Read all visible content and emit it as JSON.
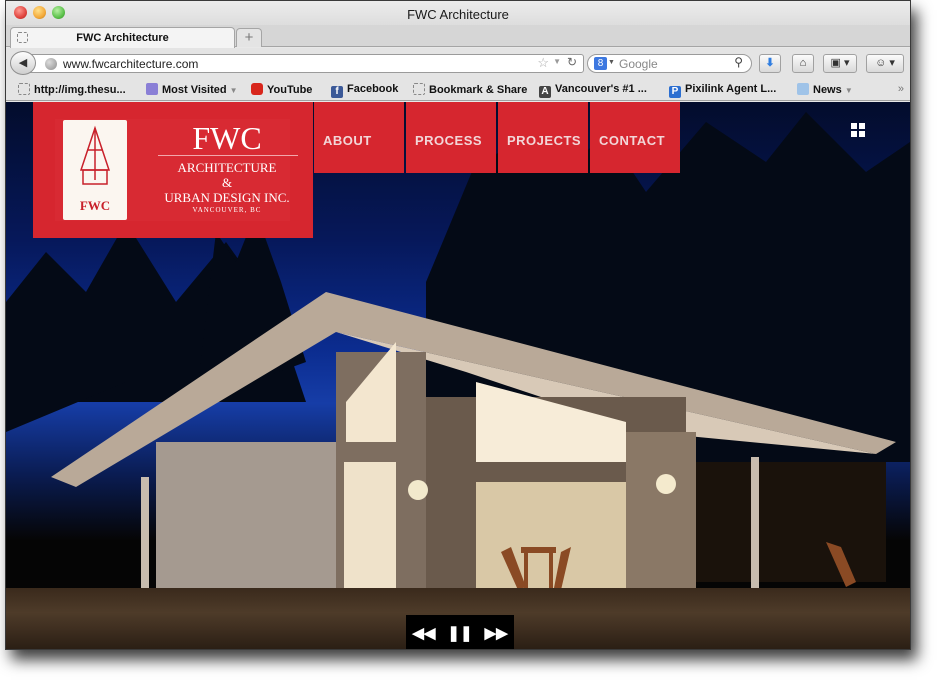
{
  "window": {
    "title": "FWC Architecture"
  },
  "tabs": [
    {
      "label": "FWC Architecture",
      "active": true
    }
  ],
  "new_tab_label": "+",
  "navbar": {
    "back_icon": "back-arrow-icon",
    "url": "www.fwcarchitecture.com",
    "search_placeholder": "Google",
    "search_engine_icon": "google-icon"
  },
  "bookmarks": [
    {
      "label": "http://img.thesu...",
      "icon": "page-icon"
    },
    {
      "label": "Most Visited",
      "icon": "smart-folder-icon",
      "dropdown": true
    },
    {
      "label": "YouTube",
      "icon": "youtube-icon"
    },
    {
      "label": "Facebook",
      "icon": "facebook-icon"
    },
    {
      "label": "Bookmark & Share",
      "icon": "page-icon"
    },
    {
      "label": "Vancouver's #1 ...",
      "icon": "a-icon"
    },
    {
      "label": "Pixilink Agent L...",
      "icon": "p-icon"
    },
    {
      "label": "News",
      "icon": "folder-icon",
      "dropdown": true
    }
  ],
  "bookmarks_overflow": "»",
  "site": {
    "brand_color": "#d6262f",
    "logo": {
      "mark_text": "FWC",
      "name": "FWC",
      "line1": "ARCHITECTURE",
      "line2": "&",
      "line3": "URBAN DESIGN INC.",
      "line4": "VANCOUVER, BC"
    },
    "nav": [
      {
        "label": "ABOUT"
      },
      {
        "label": "PROCESS"
      },
      {
        "label": "PROJECTS"
      },
      {
        "label": "CONTACT"
      }
    ],
    "slideshow": {
      "image": "modern house with glowing windows at dusk among pine trees",
      "controls": {
        "prev": "◀◀",
        "pause": "❚❚",
        "next": "▶▶"
      }
    }
  }
}
